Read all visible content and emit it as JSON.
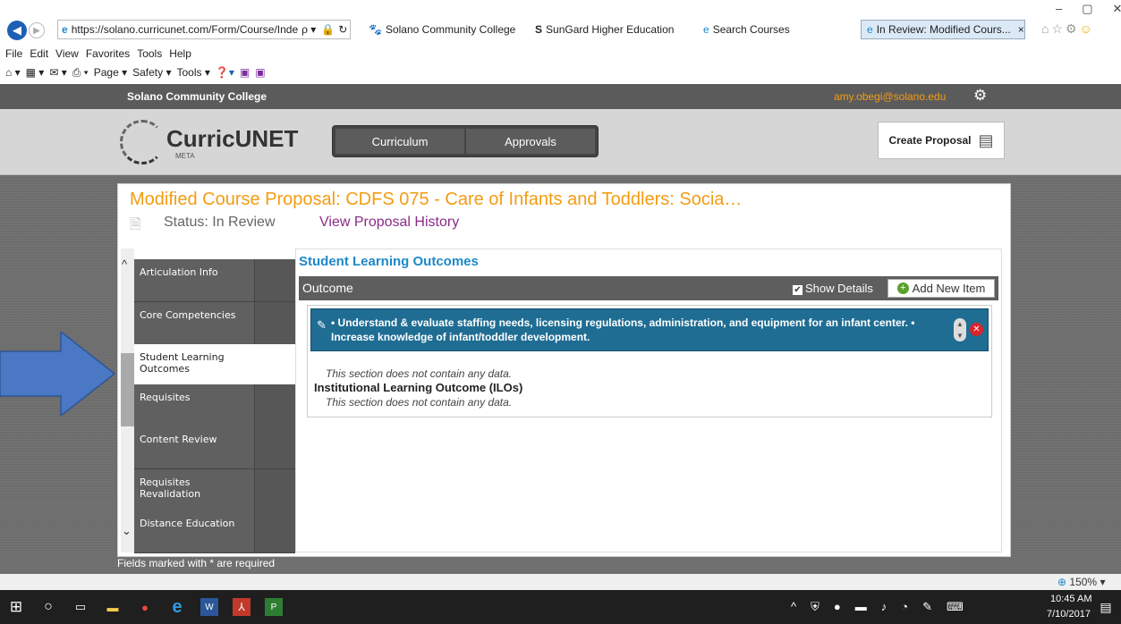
{
  "browser": {
    "url": "https://solano.curricunet.com/Form/Course/Inde",
    "search_glyph": "ρ ▾",
    "tabs": [
      {
        "label": "Solano Community College"
      },
      {
        "label": "SunGard Higher Education"
      },
      {
        "label": "Search Courses"
      },
      {
        "label": "In Review: Modified Cours..."
      }
    ],
    "close_tab": "×",
    "window_controls": {
      "minimize": "–",
      "restore": "▢",
      "close": "✕"
    },
    "menu": [
      "File",
      "Edit",
      "View",
      "Favorites",
      "Tools",
      "Help"
    ],
    "command_bar": [
      "Page ▾",
      "Safety ▾",
      "Tools ▾"
    ],
    "zoom": "150%"
  },
  "app": {
    "institution": "Solano Community College",
    "user_email": "amy.obegi@solano.edu",
    "logo_text": "CurricUNET",
    "logo_sub": "META",
    "nav": [
      "Curriculum",
      "Approvals"
    ],
    "create_proposal": "Create Proposal"
  },
  "proposal": {
    "title": "Modified Course Proposal: CDFS 075 - Care of Infants and Toddlers: Socia…",
    "status": "Status: In Review",
    "history_link": "View Proposal History"
  },
  "sidebar": {
    "items": [
      {
        "label": "Articulation Info"
      },
      {
        "label": "Core Competencies"
      },
      {
        "label": "Student Learning Outcomes",
        "active": true
      },
      {
        "label": "Requisites"
      },
      {
        "label": "Content Review"
      },
      {
        "label": "Requisites Revalidation"
      },
      {
        "label": "Distance Education"
      }
    ]
  },
  "content": {
    "section_title": "Student Learning Outcomes",
    "table_header": "Outcome",
    "show_details": "Show Details",
    "add_new_item": "Add New Item",
    "outcome_text": "• Understand & evaluate staffing needs, licensing regulations, administration, and equipment for an infant center. • Increase knowledge of infant/toddler development.",
    "no_data_1": "This section does not contain any data.",
    "ilo_heading": "Institutional Learning Outcome (ILOs)",
    "no_data_2": "This section does not contain any data.",
    "required_note": "Fields marked with * are required"
  },
  "taskbar": {
    "time": "10:45 AM",
    "date": "7/10/2017"
  },
  "colors": {
    "accent_orange": "#f39c12",
    "link_purple": "#8a2b8a",
    "section_blue": "#1e88c8",
    "outcome_bar": "#1f6d93",
    "arrow_blue": "#4a78c4"
  }
}
